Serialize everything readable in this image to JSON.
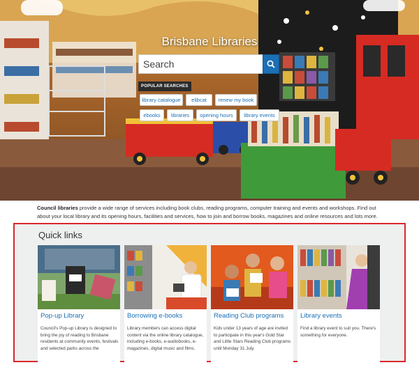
{
  "hero": {
    "title": "Brisbane Libraries",
    "search_placeholder": "Search",
    "popular_label": "POPULAR SEARCHES",
    "chips": [
      "library catalogue",
      "elibcat",
      "renew my book",
      "ebooks",
      "libraries",
      "opening hours",
      "library events"
    ]
  },
  "intro": {
    "lead": "Council libraries",
    "text": " provide a wide range of services including book clubs, reading programs, computer training and events and workshops. Find out about your local library and its opening hours, facilities and services, how to join and borrow books, magazines and online resources and lots more."
  },
  "quick_links": {
    "title": "Quick links",
    "cards": [
      {
        "title": "Pop-up Library",
        "desc": "Council's Pop-up Library is designed to bring the joy of reading to Brisbane residents at community events, festivals and selected parks across the"
      },
      {
        "title": "Borrowing e-books",
        "desc": "Library members can access digital content via the online library catalogue, including e-books, e-audiobooks, e-magazines, digital music and films."
      },
      {
        "title": "Reading Club programs",
        "desc": "Kids under 13 years of age are invited to participate in this year's Gold Star and Little Stars Reading Club programs until Monday 31 July."
      },
      {
        "title": "Library events",
        "desc": "Find a library event to suit you. There's something for everyone."
      }
    ]
  },
  "colors": {
    "accent": "#1a6fb5",
    "highlight_border": "#d9272e",
    "popular_bg": "#2b2b2b"
  },
  "icons": {
    "search": "search-icon"
  }
}
